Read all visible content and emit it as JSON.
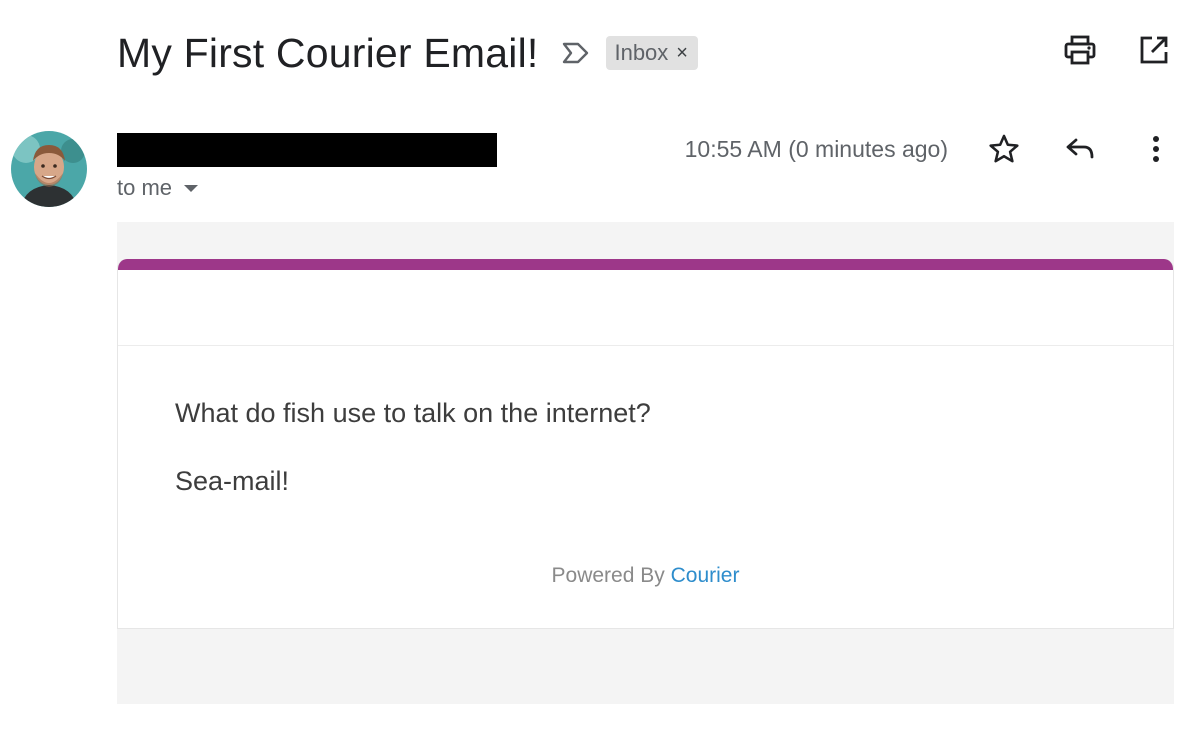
{
  "email": {
    "subject": "My First Courier Email!",
    "label_chip": "Inbox",
    "label_chip_close": "×",
    "recipient": "to me",
    "timestamp": "10:55 AM (0 minutes ago)"
  },
  "toolbar": {
    "icons": [
      "label-importance-icon",
      "print-icon",
      "open-in-new-window-icon",
      "star-icon",
      "reply-icon",
      "more-vert-icon"
    ]
  },
  "body": {
    "line1": "What do fish use to talk on the internet?",
    "line2": "Sea-mail!",
    "powered_prefix": "Powered By",
    "powered_link": "Courier"
  },
  "colors": {
    "accent": "#9d3789",
    "link": "#2e8dcc",
    "body_bg": "#f4f4f4"
  }
}
